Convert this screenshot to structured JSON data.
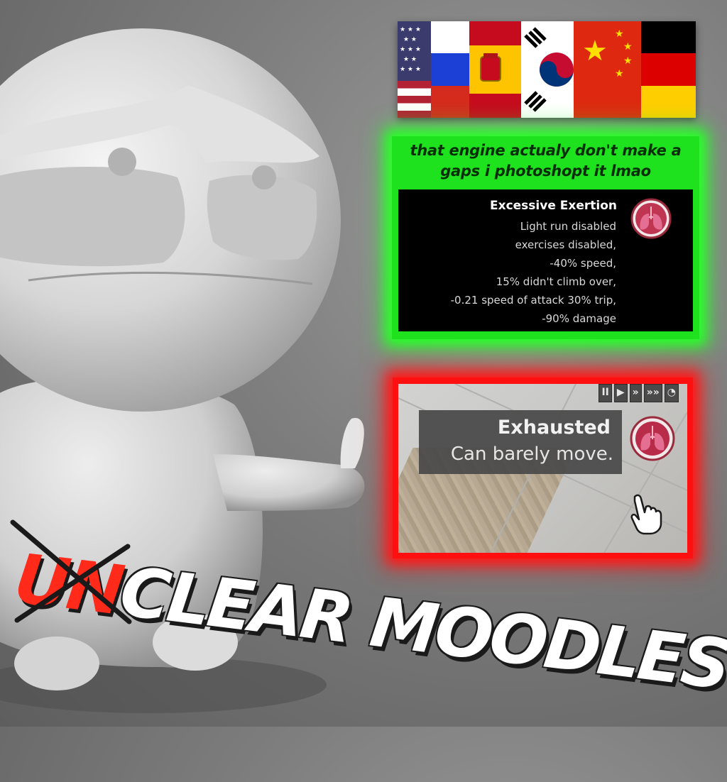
{
  "flags": [
    "United States",
    "Russia",
    "Spain",
    "South Korea",
    "China",
    "Germany"
  ],
  "green_box": {
    "caption_line1": "that engine actualy don't make a",
    "caption_line2": "gaps i photoshopt it lmao",
    "panel": {
      "title": "Excessive Exertion",
      "lines": [
        "Light run disabled",
        "exercises disabled,",
        "-40% speed,",
        "15% didn't climb over,",
        "-0.21 speed of attack 30% trip,",
        "-90% damage"
      ],
      "icon": "lungs-icon"
    }
  },
  "red_box": {
    "speed_controls": [
      "pause",
      "play",
      "fast-forward",
      "faster",
      "wait"
    ],
    "speed_symbols": [
      "II",
      "▶",
      "»",
      "»»",
      "◔"
    ],
    "tooltip": {
      "title": "Exhausted",
      "description": "Can barely move.",
      "icon": "lungs-icon"
    },
    "cursor": "hand-pointer-icon"
  },
  "title": {
    "prefix_crossed": "UN",
    "main": "CLEAR MOODLES"
  },
  "colors": {
    "green_glow": "#2aff2a",
    "red_glow": "#ff1a1a",
    "prefix_red": "#ff2a1a",
    "title_white": "#ffffff"
  }
}
